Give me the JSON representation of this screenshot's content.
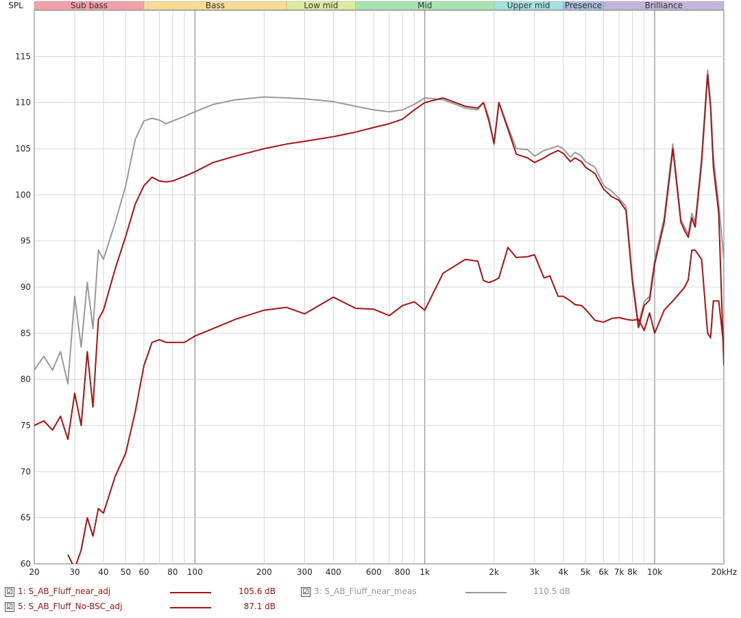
{
  "chart_data": {
    "type": "line",
    "title": "",
    "ylabel": "SPL",
    "xlabel": "",
    "x_scale": "log",
    "xlim": [
      20,
      20000
    ],
    "ylim": [
      60,
      120
    ],
    "grid": true,
    "y_ticks": [
      60,
      65,
      70,
      75,
      80,
      85,
      90,
      95,
      100,
      105,
      110,
      115
    ],
    "x_ticks": [
      {
        "v": 20,
        "label": "20"
      },
      {
        "v": 30,
        "label": "30"
      },
      {
        "v": 40,
        "label": "40"
      },
      {
        "v": 50,
        "label": "50"
      },
      {
        "v": 60,
        "label": "60"
      },
      {
        "v": 80,
        "label": "80"
      },
      {
        "v": 100,
        "label": "100"
      },
      {
        "v": 200,
        "label": "200"
      },
      {
        "v": 300,
        "label": "300"
      },
      {
        "v": 400,
        "label": "400"
      },
      {
        "v": 600,
        "label": "600"
      },
      {
        "v": 800,
        "label": "800"
      },
      {
        "v": 1000,
        "label": "1k"
      },
      {
        "v": 2000,
        "label": "2k"
      },
      {
        "v": 3000,
        "label": "3k"
      },
      {
        "v": 4000,
        "label": "4k"
      },
      {
        "v": 5000,
        "label": "5k"
      },
      {
        "v": 6000,
        "label": "6k"
      },
      {
        "v": 7000,
        "label": "7k"
      },
      {
        "v": 8000,
        "label": "8k"
      },
      {
        "v": 10000,
        "label": "10k"
      },
      {
        "v": 20000,
        "label": "20kHz"
      }
    ],
    "bands": [
      {
        "name": "Sub bass",
        "from": 20,
        "to": 60,
        "color": "#f4a0a8"
      },
      {
        "name": "Bass",
        "from": 60,
        "to": 250,
        "color": "#fadc94"
      },
      {
        "name": "Low mid",
        "from": 250,
        "to": 500,
        "color": "#dcec9c"
      },
      {
        "name": "Mid",
        "from": 500,
        "to": 2000,
        "color": "#a8e4b0"
      },
      {
        "name": "Upper mid",
        "from": 2000,
        "to": 4000,
        "color": "#a4e0e0"
      },
      {
        "name": "Presence",
        "from": 4000,
        "to": 6000,
        "color": "#a4bce0"
      },
      {
        "name": "Brilliance",
        "from": 6000,
        "to": 20000,
        "color": "#c4b4dc"
      }
    ],
    "series": [
      {
        "name": "S_AB_Fluff_near_meas",
        "color": "#999999",
        "x": [
          20,
          22,
          24,
          26,
          28,
          30,
          32,
          34,
          36,
          38,
          40,
          45,
          50,
          55,
          60,
          65,
          70,
          75,
          80,
          90,
          100,
          120,
          150,
          200,
          250,
          300,
          400,
          500,
          600,
          700,
          800,
          900,
          1000,
          1200,
          1500,
          1700,
          1800,
          1900,
          2000,
          2100,
          2300,
          2500,
          2800,
          3000,
          3300,
          3500,
          3800,
          4000,
          4300,
          4500,
          4800,
          5000,
          5500,
          6000,
          6500,
          7000,
          7500,
          8000,
          8500,
          9000,
          9500,
          10000,
          11000,
          12000,
          13000,
          13500,
          14000,
          14500,
          15000,
          16000,
          17000,
          17500,
          18000,
          19000,
          20000
        ],
        "y": [
          81,
          82.5,
          81,
          83,
          79.5,
          89,
          83.5,
          90.5,
          85.5,
          94,
          93,
          97,
          101,
          106,
          108,
          108.3,
          108.1,
          107.7,
          108,
          108.5,
          109,
          109.8,
          110.3,
          110.6,
          110.5,
          110.4,
          110.1,
          109.6,
          109.2,
          109,
          109.2,
          109.8,
          110.5,
          110.3,
          109.4,
          109.2,
          110,
          108.4,
          105.4,
          110,
          107.4,
          105,
          104.9,
          104.2,
          104.8,
          105,
          105.3,
          105,
          104.1,
          104.6,
          104.2,
          103.6,
          103,
          101,
          100.4,
          99.6,
          98.7,
          91,
          86,
          88.4,
          89,
          93,
          97.5,
          105.5,
          97.3,
          96.5,
          95.7,
          98,
          97,
          104,
          113.5,
          110,
          104,
          99,
          93
        ]
      },
      {
        "name": "S_AB_Fluff_near_adj",
        "color": "#aa1111",
        "x": [
          20,
          22,
          24,
          26,
          28,
          30,
          32,
          34,
          36,
          38,
          40,
          45,
          50,
          55,
          60,
          65,
          70,
          75,
          80,
          90,
          100,
          120,
          150,
          200,
          250,
          300,
          400,
          500,
          600,
          700,
          800,
          900,
          1000,
          1200,
          1500,
          1700,
          1800,
          1900,
          2000,
          2100,
          2300,
          2500,
          2800,
          3000,
          3300,
          3500,
          3800,
          4000,
          4300,
          4500,
          4800,
          5000,
          5500,
          6000,
          6500,
          7000,
          7500,
          8000,
          8500,
          9000,
          9500,
          10000,
          11000,
          12000,
          13000,
          13500,
          14000,
          14500,
          15000,
          16000,
          17000,
          17500,
          18000,
          19000,
          20000
        ],
        "y": [
          75,
          75.5,
          74.5,
          76,
          73.5,
          78.5,
          75,
          83,
          77,
          86.5,
          87.5,
          92,
          95.5,
          99,
          101,
          101.9,
          101.5,
          101.4,
          101.5,
          102,
          102.5,
          103.5,
          104.2,
          105,
          105.5,
          105.8,
          106.3,
          106.8,
          107.3,
          107.7,
          108.2,
          109.2,
          110,
          110.5,
          109.6,
          109.4,
          110,
          108,
          105.6,
          110,
          107.1,
          104.4,
          104,
          103.5,
          104,
          104.4,
          104.8,
          104.5,
          103.6,
          104,
          103.6,
          103,
          102.3,
          100.6,
          99.8,
          99.4,
          98.3,
          90.6,
          85.6,
          88,
          88.6,
          92.5,
          97,
          105,
          97,
          96.1,
          95.4,
          97.5,
          96.5,
          103.5,
          113,
          109.5,
          103,
          98,
          81.5
        ]
      },
      {
        "name": "S_AB_Fluff_No-BSC_adj",
        "color": "#aa1111",
        "x": [
          28,
          30,
          32,
          34,
          36,
          38,
          40,
          45,
          50,
          55,
          60,
          65,
          70,
          75,
          80,
          90,
          100,
          120,
          150,
          200,
          250,
          300,
          400,
          500,
          600,
          700,
          800,
          900,
          1000,
          1200,
          1500,
          1700,
          1800,
          1900,
          2000,
          2100,
          2300,
          2500,
          2800,
          3000,
          3300,
          3500,
          3800,
          4000,
          4300,
          4500,
          4800,
          5000,
          5500,
          6000,
          6500,
          7000,
          7500,
          8000,
          8500,
          9000,
          9500,
          10000,
          11000,
          12000,
          13000,
          13500,
          14000,
          14500,
          15000,
          16000,
          17000,
          17500,
          18000,
          19000,
          20000
        ],
        "y": [
          61,
          59.5,
          61.5,
          65,
          63,
          66,
          65.5,
          69.5,
          72,
          76.5,
          81.5,
          84,
          84.3,
          84,
          84,
          84,
          84.7,
          85.5,
          86.5,
          87.5,
          87.8,
          87.1,
          88.9,
          87.7,
          87.6,
          86.9,
          88,
          88.4,
          87.5,
          91.5,
          93,
          92.8,
          90.7,
          90.5,
          90.7,
          91,
          94.3,
          93.2,
          93.3,
          93.5,
          91,
          91.2,
          89,
          89,
          88.5,
          88.1,
          88,
          87.6,
          86.4,
          86.2,
          86.6,
          86.7,
          86.5,
          86.4,
          86.5,
          85.3,
          87.2,
          85,
          87.5,
          88.5,
          89.5,
          90,
          90.8,
          94,
          94,
          93,
          85,
          84.5,
          88.5,
          88.5,
          83.5
        ]
      }
    ]
  },
  "legend": [
    {
      "checkbox": "☑",
      "label": "1: S_AB_Fluff_near_adj",
      "value": "105.6 dB",
      "color": "#aa1111",
      "muted": false
    },
    {
      "checkbox": "☑",
      "label": "5: S_AB_Fluff_No-BSC_adj",
      "value": "87.1 dB",
      "color": "#aa1111",
      "muted": false
    },
    {
      "checkbox": "☑",
      "label": "3: S_AB_Fluff_near_meas",
      "value": "110.5 dB",
      "color": "#999999",
      "muted": true
    }
  ]
}
